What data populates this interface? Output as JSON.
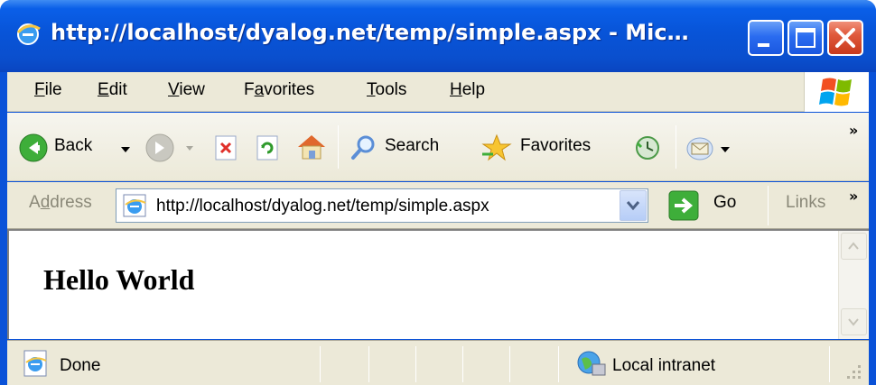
{
  "window": {
    "title": "http://localhost/dyalog.net/temp/simple.aspx - Mic…",
    "icon": "ie-icon"
  },
  "menu": {
    "items": [
      {
        "label_pre": "",
        "label_ul": "F",
        "label_post": "ile"
      },
      {
        "label_pre": "",
        "label_ul": "E",
        "label_post": "dit"
      },
      {
        "label_pre": "",
        "label_ul": "V",
        "label_post": "iew"
      },
      {
        "label_pre": "F",
        "label_ul": "a",
        "label_post": "vorites"
      },
      {
        "label_pre": "",
        "label_ul": "T",
        "label_post": "ools"
      },
      {
        "label_pre": "",
        "label_ul": "H",
        "label_post": "elp"
      }
    ]
  },
  "toolbar": {
    "back_label": "Back",
    "search_label": "Search",
    "favorites_label": "Favorites",
    "overflow": "»"
  },
  "address": {
    "label_pre": "A",
    "label_ul": "d",
    "label_post": "dress",
    "url": "http://localhost/dyalog.net/temp/simple.aspx",
    "go_label": "Go",
    "links_label": "Links",
    "overflow": "»"
  },
  "page": {
    "heading": "Hello World"
  },
  "status": {
    "text": "Done",
    "zone": "Local intranet"
  },
  "colors": {
    "titlebar": "#0a54d8",
    "chrome": "#ece9d8",
    "close_button": "#d9472a"
  }
}
